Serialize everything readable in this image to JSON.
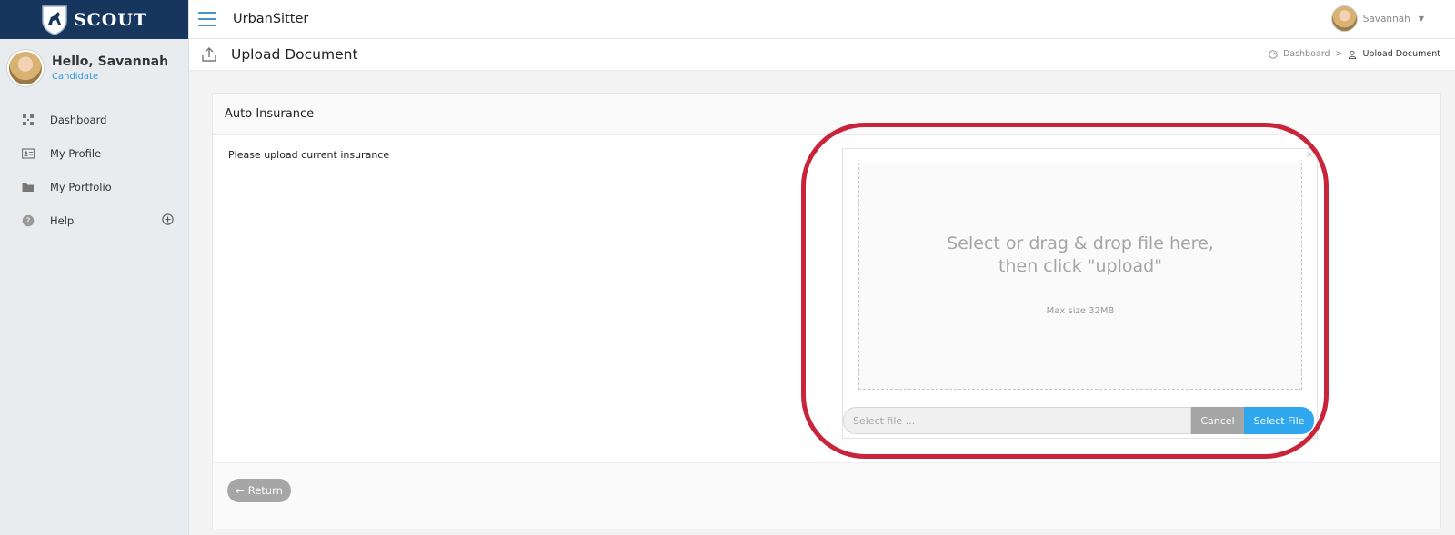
{
  "brand": {
    "name": "SCOUT"
  },
  "user": {
    "greeting": "Hello, Savannah",
    "role": "Candidate",
    "name": "Savannah"
  },
  "sidebar": {
    "items": [
      {
        "label": "Dashboard",
        "icon": "dashboard-icon"
      },
      {
        "label": "My Profile",
        "icon": "profile-card-icon"
      },
      {
        "label": "My Portfolio",
        "icon": "folder-icon"
      },
      {
        "label": "Help",
        "icon": "help-icon",
        "expand_icon": "plus-circle-icon"
      }
    ]
  },
  "header": {
    "org": "UrbanSitter"
  },
  "page": {
    "title": "Upload Document",
    "icon": "upload-icon"
  },
  "breadcrumb": {
    "home": "Dashboard",
    "current": "Upload Document"
  },
  "panel": {
    "title": "Auto Insurance",
    "instruction": "Please upload current insurance",
    "dropzone": {
      "line1": "Select or drag & drop file here,",
      "line2": "then click \"upload\"",
      "max_size": "Max size 32MB"
    },
    "file_input": {
      "placeholder": "Select file ..."
    },
    "cancel_label": "Cancel",
    "select_label": "Select File",
    "return_label": "Return"
  },
  "colors": {
    "brand": "#17365d",
    "accent": "#2ea7ee",
    "highlight": "#c8243a",
    "muted_button": "#a5a5a5"
  }
}
